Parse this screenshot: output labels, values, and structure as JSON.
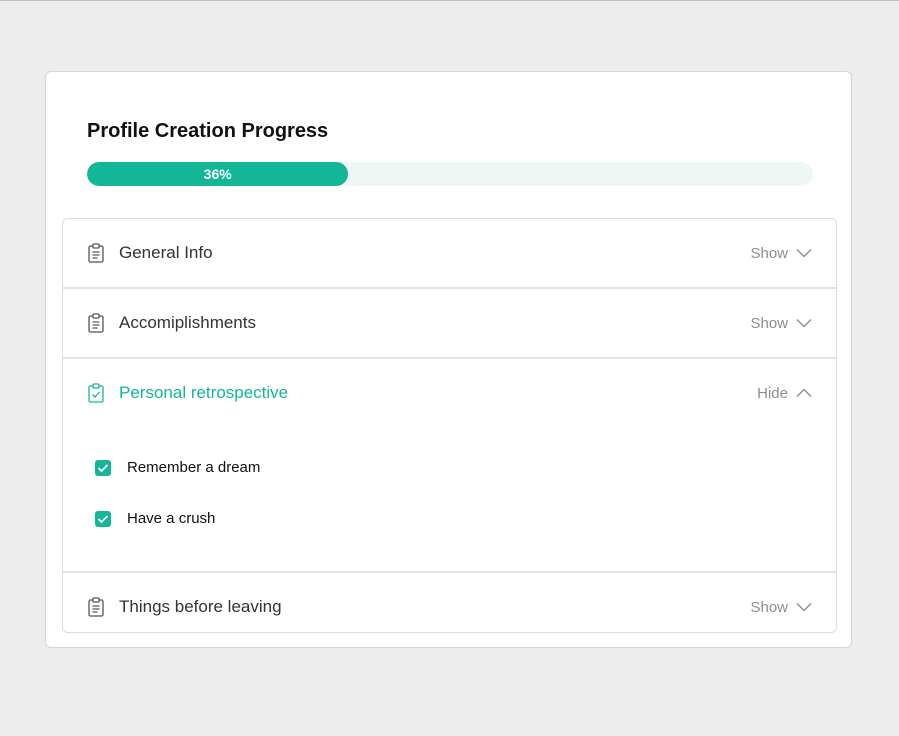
{
  "title": "Profile Creation Progress",
  "progress": {
    "value": 0.36,
    "label": "36%"
  },
  "colors": {
    "accent": "#13b697",
    "track": "#eff7f6",
    "background": "#ededed"
  },
  "sections": [
    {
      "title": "General Info",
      "toggle": "Show",
      "icon": "clipboard-list-icon",
      "expanded": false
    },
    {
      "title": "Accomiplishments",
      "toggle": "Show",
      "icon": "clipboard-list-icon",
      "expanded": false
    },
    {
      "title": "Personal retrospective",
      "toggle": "Hide",
      "icon": "clipboard-check-icon",
      "expanded": true,
      "items": [
        {
          "label": "Remember a dream",
          "checked": true
        },
        {
          "label": "Have a crush",
          "checked": true
        }
      ]
    },
    {
      "title": "Things before leaving",
      "toggle": "Show",
      "icon": "clipboard-list-icon",
      "expanded": false
    }
  ]
}
